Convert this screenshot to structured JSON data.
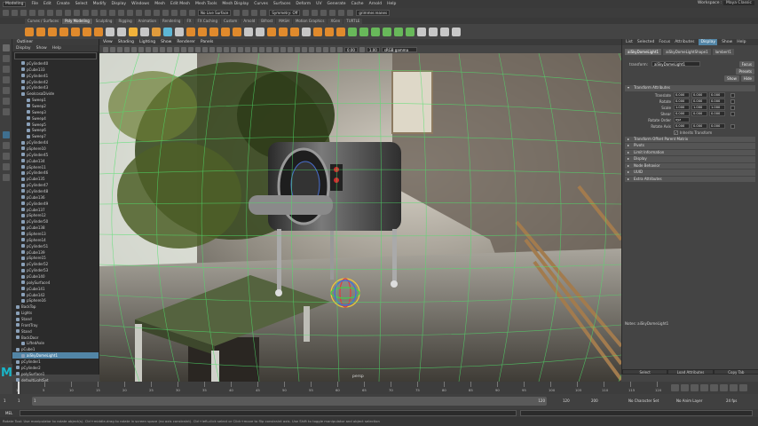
{
  "app": {
    "workspace_label": "Workspace :",
    "workspace_value": "Maya Classic",
    "mode_dropdown": "Modeling",
    "live_surface": "No Live Surface",
    "symmetry": "Symmetry: Off",
    "login": "grimmer.reanes"
  },
  "menu": [
    "File",
    "Edit",
    "Create",
    "Select",
    "Modify",
    "Display",
    "Windows",
    "Mesh",
    "Edit Mesh",
    "Mesh Tools",
    "Mesh Display",
    "Curves",
    "Surfaces",
    "Deform",
    "UV",
    "Generate",
    "Cache",
    "Arnold",
    "Help"
  ],
  "shelf_tabs": [
    "Curves / Surfaces",
    "Poly Modeling",
    "Sculpting",
    "Rigging",
    "Animation",
    "Rendering",
    "FX",
    "FX Caching",
    "Custom",
    "Arnold",
    "Bifrost",
    "MASH",
    "Motion Graphics",
    "XGen",
    "TURTLE"
  ],
  "shelf_active": 1,
  "shelf_icon_colors": [
    "#e08a2c",
    "#e08a2c",
    "#e08a2c",
    "#e08a2c",
    "#e08a2c",
    "#e08a2c",
    "#e08a2c",
    "#c7c7c7",
    "#c7c7c7",
    "#f0b23a",
    "#c7c7c7",
    "#e09b3c",
    "#5db7d6",
    "#c7c7c7",
    "#e08a2c",
    "#e08a2c",
    "#e08a2c",
    "#e08a2c",
    "#e08a2c",
    "#c7c7c7",
    "#c7c7c7",
    "#e08a2c",
    "#e08a2c",
    "#e08a2c",
    "#c7c7c7",
    "#e08a2c",
    "#e08a2c",
    "#e08a2c",
    "#68b85a",
    "#68b85a",
    "#68b85a",
    "#68b85a",
    "#68b85a",
    "#68b85a",
    "#c7c7c7",
    "#c7c7c7",
    "#c7c7c7",
    "#c7c7c7"
  ],
  "outliner": {
    "title": "Outliner",
    "menu": [
      "Display",
      "Show",
      "Help"
    ],
    "items": [
      {
        "label": "pCylinder40",
        "sel": false,
        "indent": 1
      },
      {
        "label": "pCube133",
        "sel": false,
        "indent": 1
      },
      {
        "label": "pCylinder41",
        "sel": false,
        "indent": 1
      },
      {
        "label": "pCylinder42",
        "sel": false,
        "indent": 1
      },
      {
        "label": "pCylinder43",
        "sel": false,
        "indent": 1
      },
      {
        "label": "GeoIcosaDivide",
        "sel": false,
        "indent": 1
      },
      {
        "label": "Sweep1",
        "sel": false,
        "indent": 2
      },
      {
        "label": "Sweep2",
        "sel": false,
        "indent": 2
      },
      {
        "label": "Sweep3",
        "sel": false,
        "indent": 2
      },
      {
        "label": "Sweep4",
        "sel": false,
        "indent": 2
      },
      {
        "label": "Sweep5",
        "sel": false,
        "indent": 2
      },
      {
        "label": "Sweep6",
        "sel": false,
        "indent": 2
      },
      {
        "label": "Sweep7",
        "sel": false,
        "indent": 2
      },
      {
        "label": "pCylinder44",
        "sel": false,
        "indent": 1
      },
      {
        "label": "pSphere10",
        "sel": false,
        "indent": 1
      },
      {
        "label": "pCylinder45",
        "sel": false,
        "indent": 1
      },
      {
        "label": "pCube134",
        "sel": false,
        "indent": 1
      },
      {
        "label": "pSphere11",
        "sel": false,
        "indent": 1
      },
      {
        "label": "pCylinder46",
        "sel": false,
        "indent": 1
      },
      {
        "label": "pCube135",
        "sel": false,
        "indent": 1
      },
      {
        "label": "pCylinder47",
        "sel": false,
        "indent": 1
      },
      {
        "label": "pCylinder48",
        "sel": false,
        "indent": 1
      },
      {
        "label": "pCube136",
        "sel": false,
        "indent": 1
      },
      {
        "label": "pCylinder49",
        "sel": false,
        "indent": 1
      },
      {
        "label": "pCube137",
        "sel": false,
        "indent": 1
      },
      {
        "label": "pSphere12",
        "sel": false,
        "indent": 1
      },
      {
        "label": "pCylinder50",
        "sel": false,
        "indent": 1
      },
      {
        "label": "pCube138",
        "sel": false,
        "indent": 1
      },
      {
        "label": "pSphere13",
        "sel": false,
        "indent": 1
      },
      {
        "label": "pSphere14",
        "sel": false,
        "indent": 1
      },
      {
        "label": "pCylinder51",
        "sel": false,
        "indent": 1
      },
      {
        "label": "pCube139",
        "sel": false,
        "indent": 1
      },
      {
        "label": "pSphere15",
        "sel": false,
        "indent": 1
      },
      {
        "label": "pCylinder52",
        "sel": false,
        "indent": 1
      },
      {
        "label": "pCylinder53",
        "sel": false,
        "indent": 1
      },
      {
        "label": "pCube140",
        "sel": false,
        "indent": 1
      },
      {
        "label": "polySurface4",
        "sel": false,
        "indent": 1
      },
      {
        "label": "pCube141",
        "sel": false,
        "indent": 1
      },
      {
        "label": "pCube142",
        "sel": false,
        "indent": 1
      },
      {
        "label": "pSphere16",
        "sel": false,
        "indent": 1
      },
      {
        "label": "BackTop",
        "sel": false,
        "indent": 0
      },
      {
        "label": "Lights",
        "sel": false,
        "indent": 0
      },
      {
        "label": "Stand",
        "sel": false,
        "indent": 0
      },
      {
        "label": "FrontTray",
        "sel": false,
        "indent": 0
      },
      {
        "label": "Stand",
        "sel": false,
        "indent": 0
      },
      {
        "label": "BackDoor",
        "sel": false,
        "indent": 0
      },
      {
        "label": "LiftedAxle",
        "sel": false,
        "indent": 1
      },
      {
        "label": "pCube1",
        "sel": false,
        "indent": 0
      },
      {
        "label": "aiSkyDomeLight1",
        "sel": true,
        "indent": 1
      },
      {
        "label": "pCylinder1",
        "sel": false,
        "indent": 0
      },
      {
        "label": "pCylinder2",
        "sel": false,
        "indent": 0
      },
      {
        "label": "polySurface1",
        "sel": false,
        "indent": 0
      },
      {
        "label": "defaultLightSet",
        "sel": false,
        "indent": 0
      },
      {
        "label": "defaultObjectSet",
        "sel": false,
        "indent": 0
      }
    ]
  },
  "viewport": {
    "menu": [
      "View",
      "Shading",
      "Lighting",
      "Show",
      "Renderer",
      "Panels"
    ],
    "exposure": "0.00",
    "gamma": "1.00",
    "color_space": "sRGB gamma",
    "camera_label": "persp"
  },
  "attr_editor": {
    "menu": [
      "List",
      "Selected",
      "Focus",
      "Attributes",
      "Display",
      "Show",
      "Help"
    ],
    "menu_highlight": 4,
    "tabs": [
      "aiSkyDomeLight1",
      "aiSkyDomeLightShape1",
      "lambert1"
    ],
    "transform_label": "transform:",
    "transform_value": "aiSkyDomeLight1",
    "buttons": [
      "Focus",
      "Presets",
      "Show",
      "Hide"
    ],
    "section_open": "Transform Attributes",
    "rows": [
      {
        "label": "Translate",
        "values": [
          "0.000",
          "0.000",
          "0.000"
        ]
      },
      {
        "label": "Rotate",
        "values": [
          "0.000",
          "0.000",
          "0.000"
        ]
      },
      {
        "label": "Scale",
        "values": [
          "1.000",
          "1.000",
          "1.000"
        ]
      },
      {
        "label": "Shear",
        "values": [
          "0.000",
          "0.000",
          "0.000"
        ]
      },
      {
        "label": "Rotate Order",
        "values": [
          "xyz"
        ]
      },
      {
        "label": "Rotate Axis",
        "values": [
          "0.000",
          "0.000",
          "0.000"
        ]
      }
    ],
    "checkbox_label": "Inherits Transform",
    "sections": [
      "Pivots",
      "Limit Information",
      "Display",
      "Node Behavior",
      "UUID",
      "Extra Attributes"
    ],
    "transform_offset": "Transform Offset Parent Matrix",
    "notes_label": "Notes: aiSkyDomeLight1",
    "bottom_buttons": [
      "Select",
      "Load Attributes",
      "Copy Tab"
    ]
  },
  "timeline": {
    "ticks": [
      "1",
      "5",
      "10",
      "15",
      "20",
      "25",
      "30",
      "35",
      "40",
      "45",
      "50",
      "55",
      "60",
      "65",
      "70",
      "75",
      "80",
      "85",
      "90",
      "95",
      "100",
      "105",
      "110",
      "115",
      "120"
    ],
    "range_start": "1",
    "range_start2": "1",
    "range_end": "120",
    "range_end2": "120",
    "anim_end": "200",
    "char_set": "No Character Set",
    "anim_layer": "No Anim Layer",
    "fps": "24 fps"
  },
  "command": {
    "lang": "MEL"
  },
  "help_text": "Rotate Tool: Use manipulator to rotate object(s). Ctrl+middle-drag to rotate in screen space (no axis constraint). Ctrl+left-click select or Click+move to flip constraint axis. Use Shift to toggle manipulator and object selection",
  "logo": "M"
}
